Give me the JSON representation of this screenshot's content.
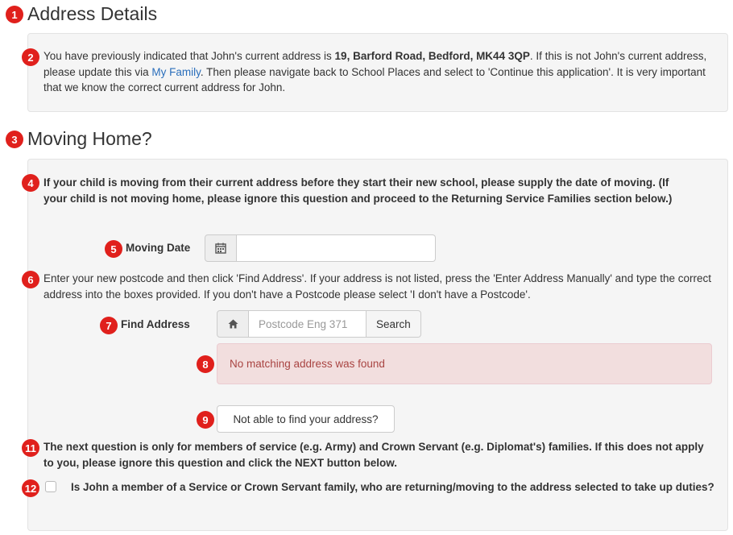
{
  "badges": [
    "1",
    "2",
    "3",
    "4",
    "5",
    "6",
    "7",
    "8",
    "9",
    "11",
    "12"
  ],
  "address_details": {
    "title": "Address Details",
    "text_before": "You have previously indicated that John's current address is ",
    "address": "19, Barford Road, Bedford, MK44 3QP",
    "text_mid": ". If this is not John's current address, please update this via ",
    "link": "My Family",
    "text_after": ". Then please navigate back to School Places and select to 'Continue this application'. It is very important that we know the correct current address for John."
  },
  "moving_home": {
    "title": "Moving Home?",
    "intro": "If your child is moving from their current address before they start their new school, please supply the date of moving. (If your child is not moving home, please ignore this question and proceed to the Returning Service Families section below.)",
    "moving_date_label": "Moving Date",
    "moving_date_value": "",
    "instructions": "Enter your new postcode and then click 'Find Address'. If your address is not listed, press the 'Enter Address Manually' and type the correct address into the boxes provided. If you don't have a Postcode please select 'I don't have a Postcode'.",
    "find_address_label": "Find Address",
    "postcode_value": "Postcode Eng 371",
    "search_label": "Search",
    "alert": "No matching address was found",
    "not_able_label": "Not able to find your address?",
    "service_note": "The next question is only for members of service (e.g. Army) and Crown Servant (e.g. Diplomat's) families. If this does not apply to you, please ignore this question and click the NEXT button below.",
    "service_question": "Is John a member of a Service or Crown Servant family, who are returning/moving to the address selected to take up duties?",
    "service_checked": false
  },
  "icons": {
    "calendar": "calendar-icon",
    "home": "home-icon"
  },
  "colors": {
    "badge": "#e0201c",
    "link": "#2a6ebb",
    "alert_bg": "#f2dede",
    "alert_text": "#a94442"
  }
}
